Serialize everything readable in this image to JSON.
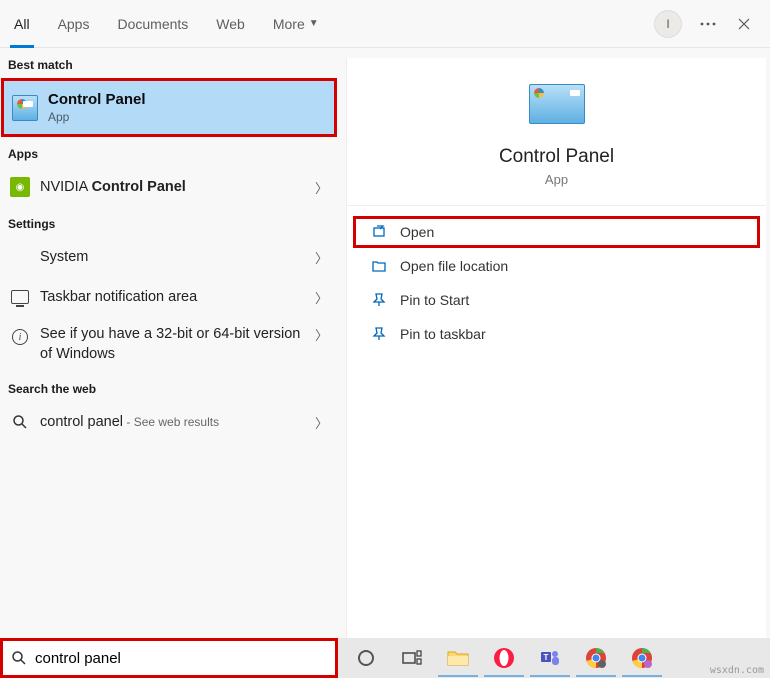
{
  "header": {
    "tabs": [
      "All",
      "Apps",
      "Documents",
      "Web",
      "More"
    ],
    "avatar_initial": "I"
  },
  "left": {
    "best_match_label": "Best match",
    "best_match": {
      "title": "Control Panel",
      "subtitle": "App"
    },
    "apps_label": "Apps",
    "apps": [
      {
        "prefix": "NVIDIA ",
        "bold": "Control Panel"
      }
    ],
    "settings_label": "Settings",
    "settings": [
      "System",
      "Taskbar notification area",
      "See if you have a 32-bit or 64-bit version of Windows"
    ],
    "web_label": "Search the web",
    "web": {
      "query": "control panel",
      "suffix": " - See web results"
    }
  },
  "preview": {
    "title": "Control Panel",
    "subtitle": "App",
    "actions": [
      "Open",
      "Open file location",
      "Pin to Start",
      "Pin to taskbar"
    ]
  },
  "search": {
    "value": "control panel"
  },
  "watermark": "wsxdn.com"
}
